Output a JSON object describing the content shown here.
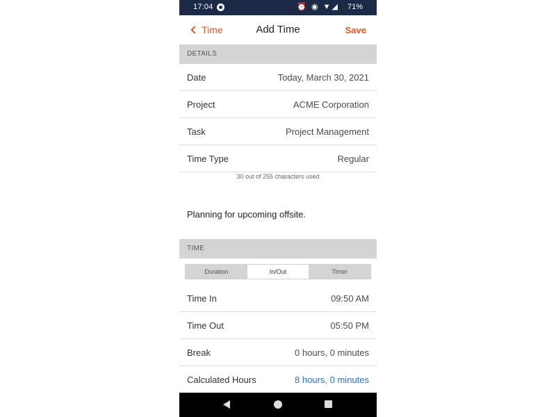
{
  "status_bar": {
    "time": "17:04",
    "icons": "⏰ ◉ ▼◢",
    "battery": "71%"
  },
  "nav": {
    "back_label": "Time",
    "title": "Add Time",
    "save_label": "Save"
  },
  "details": {
    "header": "DETAILS",
    "rows": [
      {
        "label": "Date",
        "value": "Today, March 30, 2021"
      },
      {
        "label": "Project",
        "value": "ACME Corporation"
      },
      {
        "label": "Task",
        "value": "Project Management"
      },
      {
        "label": "Time Type",
        "value": "Regular"
      }
    ],
    "char_counter": "30 out of 255 characters used",
    "notes": "Planning for upcoming offsite."
  },
  "time_section": {
    "header": "TIME",
    "tabs": [
      "Duration",
      "In/Out",
      "Timer"
    ],
    "selected_tab": "In/Out",
    "rows": [
      {
        "label": "Time In",
        "value": "09:50 AM"
      },
      {
        "label": "Time Out",
        "value": "05:50 PM"
      },
      {
        "label": "Break",
        "value": "0 hours, 0 minutes"
      },
      {
        "label": "Calculated Hours",
        "value": "8 hours, 0 minutes"
      }
    ]
  },
  "colors": {
    "accent": "#e5562b",
    "status_bar": "#1c2a47",
    "link_blue": "#2f6fbf",
    "section_header": "#d3d4d6"
  }
}
